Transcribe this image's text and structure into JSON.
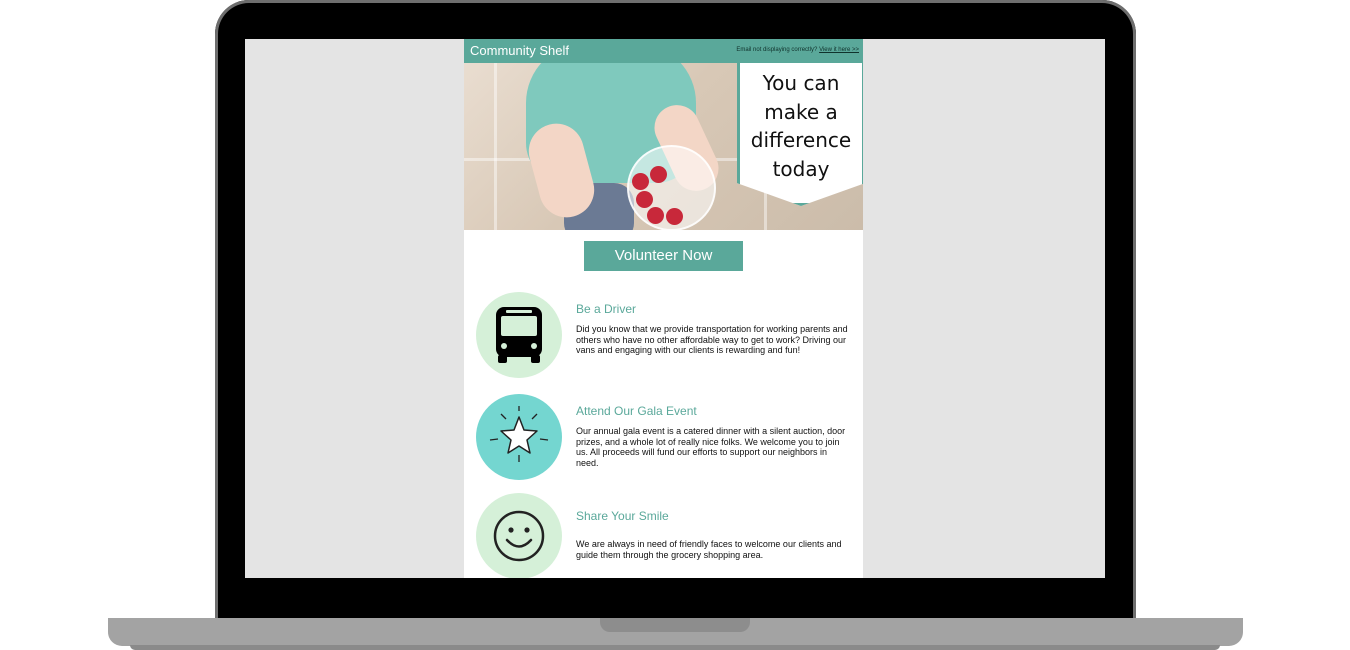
{
  "email": {
    "brand": "Community Shelf",
    "view_prompt": "Email not displaying correctly?",
    "view_link": "View it here >>",
    "hero_lines": [
      "You can",
      "make a",
      "difference",
      "today"
    ],
    "cta_label": "Volunteer Now",
    "items": [
      {
        "title": "Be a Driver",
        "description": "Did you know that we provide transportation for working parents and others who have no other affordable way to get to work? Driving our vans and engaging with our clients is rewarding and fun!",
        "icon": "bus-icon",
        "circle_color": "#d5f0d8"
      },
      {
        "title": "Attend Our Gala Event",
        "description": "Our annual gala event is a catered dinner with a silent auction, door prizes, and a whole lot of really nice folks. We welcome you to join us. All proceeds will fund our efforts to support our neighbors in need.",
        "icon": "star-icon",
        "circle_color": "#74d6d0"
      },
      {
        "title": "Share Your Smile",
        "description": "We are always in need of friendly faces to welcome our clients and guide them through the grocery shopping area.",
        "icon": "smiley-icon",
        "circle_color": "#d5f0d8"
      }
    ]
  },
  "colors": {
    "accent": "#5aa89a",
    "light_green": "#d5f0d8",
    "turquoise": "#74d6d0"
  }
}
